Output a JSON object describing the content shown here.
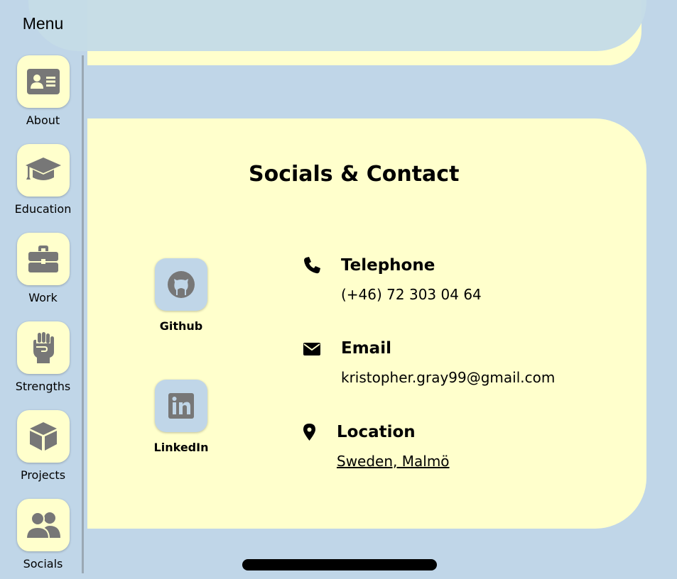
{
  "menu": {
    "title": "Menu",
    "items": [
      {
        "label": "About",
        "icon": "id-card-icon"
      },
      {
        "label": "Education",
        "icon": "graduation-cap-icon"
      },
      {
        "label": "Work",
        "icon": "briefcase-icon"
      },
      {
        "label": "Strengths",
        "icon": "fist-icon"
      },
      {
        "label": "Projects",
        "icon": "cube-icon"
      },
      {
        "label": "Socials",
        "icon": "users-icon"
      }
    ]
  },
  "section": {
    "title": "Socials & Contact",
    "socials": [
      {
        "label": "Github",
        "icon": "github-icon"
      },
      {
        "label": "LinkedIn",
        "icon": "linkedin-icon"
      }
    ],
    "contact": {
      "telephone": {
        "heading": "Telephone",
        "value": "(+46) 72 303 04 64",
        "icon": "phone-icon"
      },
      "email": {
        "heading": "Email",
        "value": "kristopher.gray99@gmail.com",
        "icon": "envelope-icon"
      },
      "location": {
        "heading": "Location",
        "value": "Sweden, Malmö",
        "icon": "map-pin-icon"
      }
    }
  },
  "colors": {
    "background": "#c0d6e8",
    "card": "#ffffcc",
    "icon_gray": "#777777"
  }
}
